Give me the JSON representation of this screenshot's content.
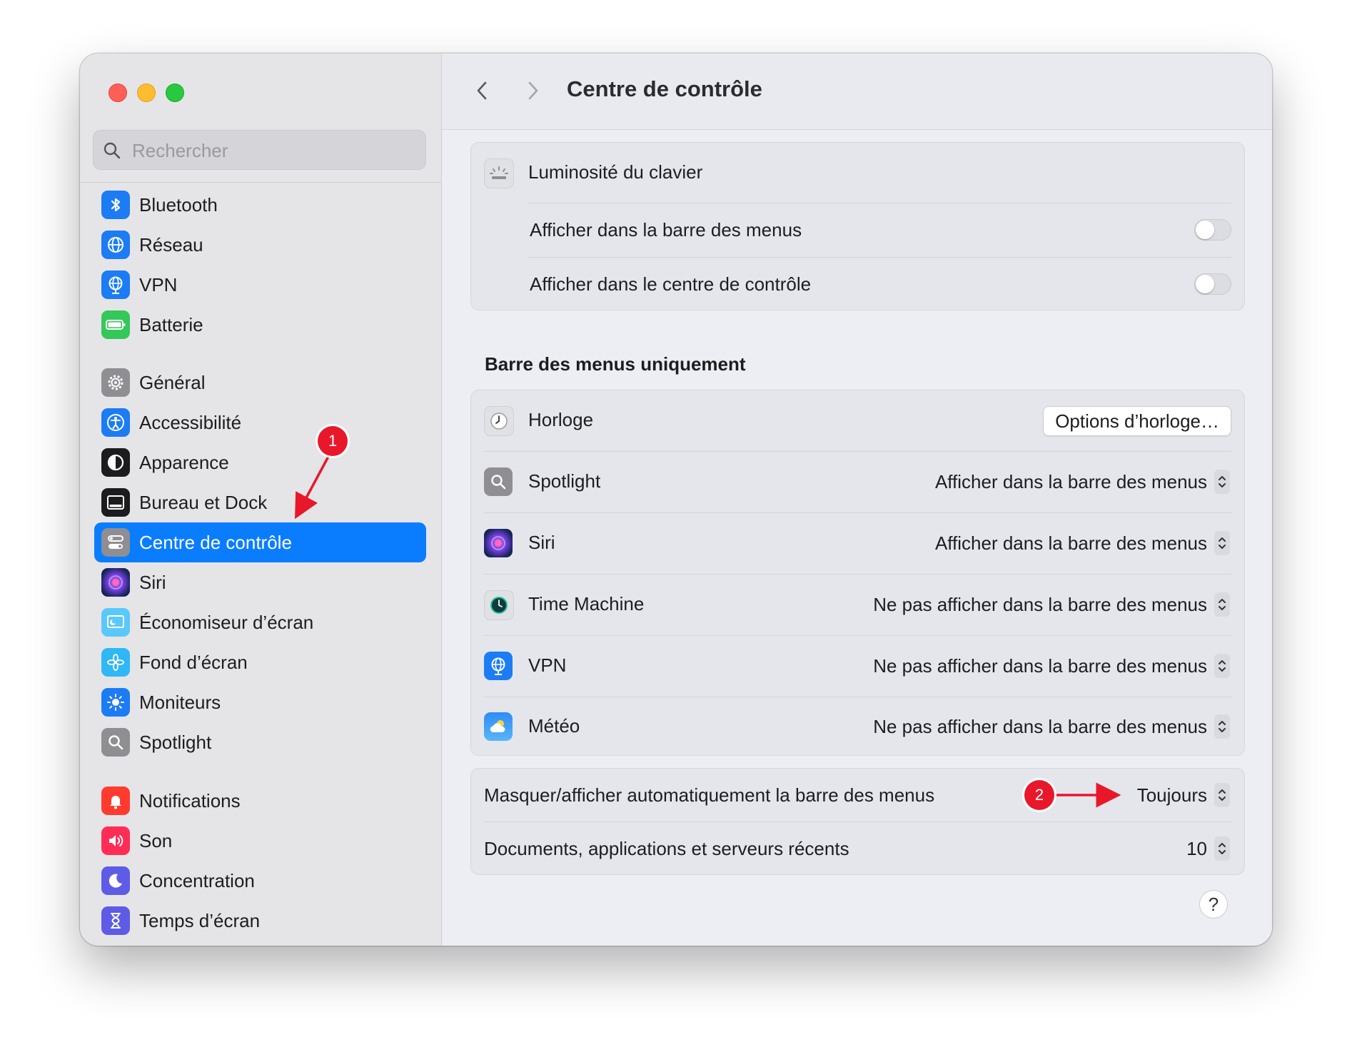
{
  "window": {
    "title": "Centre de contrôle"
  },
  "search": {
    "placeholder": "Rechercher"
  },
  "sidebar": {
    "items": [
      {
        "label": "Bluetooth",
        "icon": "bluetooth-icon"
      },
      {
        "label": "Réseau",
        "icon": "globe-icon"
      },
      {
        "label": "VPN",
        "icon": "vpn-globe-icon"
      },
      {
        "label": "Batterie",
        "icon": "battery-icon"
      },
      {
        "label": "Général",
        "icon": "gear-icon"
      },
      {
        "label": "Accessibilité",
        "icon": "accessibility-icon"
      },
      {
        "label": "Apparence",
        "icon": "appearance-icon"
      },
      {
        "label": "Bureau et Dock",
        "icon": "dock-icon"
      },
      {
        "label": "Centre de contrôle",
        "icon": "control-center-icon",
        "selected": true
      },
      {
        "label": "Siri",
        "icon": "siri-icon"
      },
      {
        "label": "Économiseur d’écran",
        "icon": "screensaver-icon"
      },
      {
        "label": "Fond d’écran",
        "icon": "wallpaper-icon"
      },
      {
        "label": "Moniteurs",
        "icon": "sun-icon"
      },
      {
        "label": "Spotlight",
        "icon": "magnifier-icon"
      },
      {
        "label": "Notifications",
        "icon": "bell-icon"
      },
      {
        "label": "Son",
        "icon": "speaker-icon"
      },
      {
        "label": "Concentration",
        "icon": "moon-icon"
      },
      {
        "label": "Temps d’écran",
        "icon": "hourglass-icon"
      }
    ]
  },
  "keyboard_group": {
    "title": "Luminosité du clavier",
    "rows": [
      {
        "label": "Afficher dans la barre des menus",
        "on": false
      },
      {
        "label": "Afficher dans le centre de contrôle",
        "on": false
      }
    ]
  },
  "menubar_only": {
    "section_title": "Barre des menus uniquement",
    "horloge": {
      "label": "Horloge",
      "button": "Options d’horloge…"
    },
    "rows": [
      {
        "label": "Spotlight",
        "value": "Afficher dans la barre des menus",
        "icon": "magnifier-icon"
      },
      {
        "label": "Siri",
        "value": "Afficher dans la barre des menus",
        "icon": "siri-icon"
      },
      {
        "label": "Time Machine",
        "value": "Ne pas afficher dans la barre des menus",
        "icon": "time-machine-icon"
      },
      {
        "label": "VPN",
        "value": "Ne pas afficher dans la barre des menus",
        "icon": "vpn-globe-icon"
      },
      {
        "label": "Météo",
        "value": "Ne pas afficher dans la barre des menus",
        "icon": "weather-icon"
      }
    ]
  },
  "bottom_group": {
    "rows": [
      {
        "label": "Masquer/afficher automatiquement la barre des menus",
        "value": "Toujours"
      },
      {
        "label": "Documents, applications et serveurs récents",
        "value": "10"
      }
    ]
  },
  "help": {
    "label": "?"
  },
  "annotations": {
    "badge1": "1",
    "badge2": "2",
    "color": "#e8182a"
  },
  "colors": {
    "accent": "#0a7dff",
    "close": "#fe5f57",
    "minimize": "#febc2e",
    "zoom": "#28c840"
  }
}
